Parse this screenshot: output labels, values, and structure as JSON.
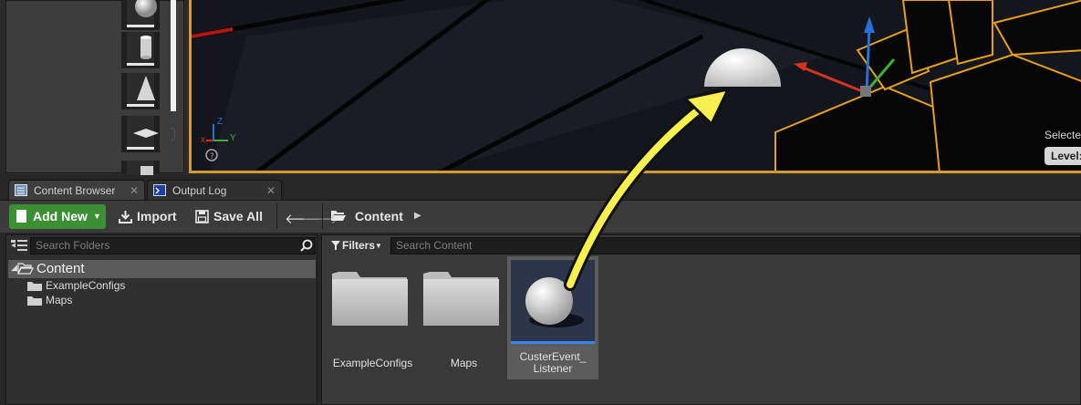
{
  "viewport": {
    "selected_label": "Selecte",
    "level_label": "Level:",
    "axis_labels": {
      "x": "x",
      "y": "Y",
      "z": "Z"
    }
  },
  "mode_panel": {
    "items": [
      {
        "name": "sphere-shape-icon"
      },
      {
        "name": "cylinder-shape-icon"
      },
      {
        "name": "cone-shape-icon"
      },
      {
        "name": "plane-shape-icon"
      },
      {
        "name": "box-shape-icon"
      }
    ]
  },
  "tabs": [
    {
      "label": "Content Browser",
      "icon": "content-browser-icon",
      "active": true
    },
    {
      "label": "Output Log",
      "icon": "output-log-icon",
      "active": false
    }
  ],
  "toolbar": {
    "add_new": "Add New",
    "import": "Import",
    "save_all": "Save All",
    "breadcrumb": "Content"
  },
  "folders": {
    "search_placeholder": "Search Folders",
    "root": "Content",
    "children": [
      "ExampleConfigs",
      "Maps"
    ]
  },
  "content": {
    "filters_label": "Filters",
    "search_placeholder": "Search Content",
    "assets": [
      {
        "name": "ExampleConfigs",
        "type": "folder"
      },
      {
        "name": "Maps",
        "type": "folder"
      },
      {
        "name_line1": "CusterEvent_",
        "name_line2": "Listener",
        "type": "actor",
        "selected": true
      }
    ]
  },
  "colors": {
    "accent_green": "#3d8f34",
    "selection_orange": "#d29b33",
    "annotation_yellow": "#f7f04f",
    "selected_asset_blue": "#3b82f6"
  }
}
